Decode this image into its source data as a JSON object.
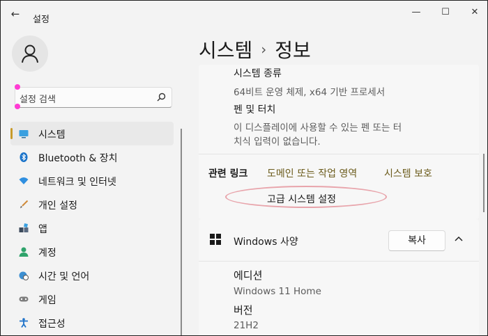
{
  "window": {
    "title": "설정",
    "back_glyph": "←",
    "minimize_glyph": "—",
    "maximize_glyph": "☐",
    "close_glyph": "✕"
  },
  "search": {
    "placeholder": "설정 검색"
  },
  "sidebar": {
    "items": [
      {
        "label": "시스템",
        "icon": "system-icon",
        "active": true
      },
      {
        "label": "Bluetooth & 장치",
        "icon": "bluetooth-icon"
      },
      {
        "label": "네트워크 및 인터넷",
        "icon": "wifi-icon"
      },
      {
        "label": "개인 설정",
        "icon": "brush-icon"
      },
      {
        "label": "앱",
        "icon": "apps-icon"
      },
      {
        "label": "계정",
        "icon": "account-icon"
      },
      {
        "label": "시간 및 언어",
        "icon": "globe-clock-icon"
      },
      {
        "label": "게임",
        "icon": "gamepad-icon"
      },
      {
        "label": "접근성",
        "icon": "accessibility-icon"
      }
    ]
  },
  "breadcrumb": {
    "parent": "시스템",
    "separator": "›",
    "current": "정보"
  },
  "device_specs": {
    "system_type_label": "시스템 종류",
    "system_type_value": "64비트 운영 체제, x64 기반 프로세서",
    "pen_touch_label": "펜 및 터치",
    "pen_touch_value_line1": "이 디스플레이에 사용할 수 있는 펜 또는 터",
    "pen_touch_value_line2": "치식 입력이 없습니다."
  },
  "related_links": {
    "title": "관련 링크",
    "links": [
      "도메인 또는 작업 영역",
      "시스템 보호"
    ],
    "advanced": "고급 시스템 설정"
  },
  "windows_spec": {
    "title": "Windows 사양",
    "copy_label": "복사",
    "edition_label": "에디션",
    "edition_value": "Windows 11 Home",
    "version_label": "버전",
    "version_value": "21H2"
  },
  "colors": {
    "accent": "#c79a2a",
    "link": "#6b5b1b",
    "highlight_ellipse": "#e8a4ab",
    "marker_dots": "#ff3bd3"
  }
}
